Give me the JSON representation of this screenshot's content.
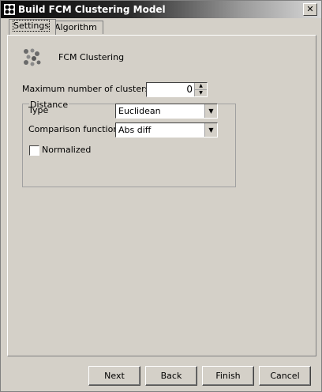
{
  "window": {
    "title": "Build FCM Clustering Model",
    "close_label": "✕"
  },
  "tabs": [
    {
      "label": "Settings",
      "active": true
    },
    {
      "label": "Algorithm",
      "active": false
    }
  ],
  "header": {
    "label": "FCM Clustering",
    "icon": "cluster-dots-icon"
  },
  "max_clusters": {
    "label": "Maximum number of clusters",
    "value": "0"
  },
  "distance": {
    "group_label": "Distance",
    "type_label": "Type",
    "type_value": "Euclidean",
    "comparison_label": "Comparison function",
    "comparison_value": "Abs diff",
    "normalized_label": "Normalized",
    "normalized_checked": false
  },
  "buttons": {
    "next": "Next",
    "back": "Back",
    "finish": "Finish",
    "cancel": "Cancel"
  }
}
